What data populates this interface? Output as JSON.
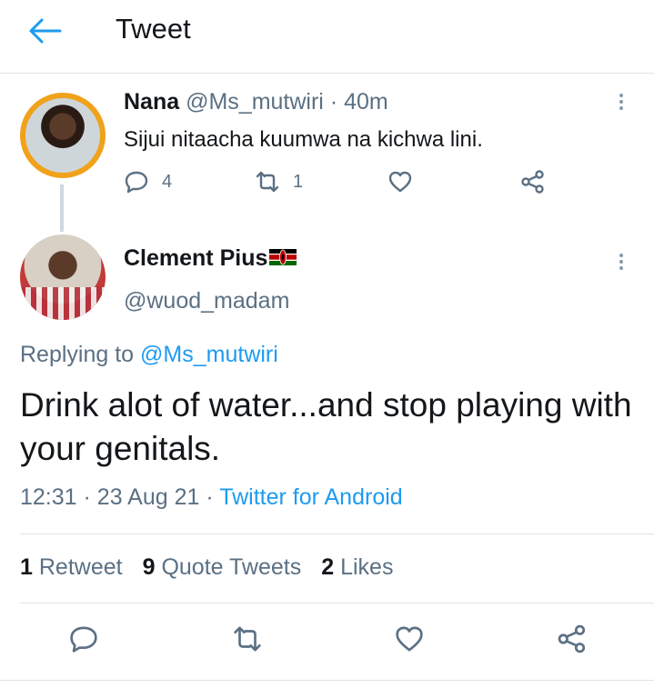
{
  "header": {
    "title": "Tweet"
  },
  "parent_tweet": {
    "name": "Nana",
    "handle": "@Ms_mutwiri",
    "separator": "·",
    "time": "40m",
    "text": "Sijui nitaacha kuumwa na kichwa lini.",
    "reply_count": "4",
    "retweet_count": "1"
  },
  "main_tweet": {
    "name": "Clement Pius",
    "handle": "@wuod_madam",
    "replying_prefix": "Replying to ",
    "replying_to": "@Ms_mutwiri",
    "text": "Drink alot of water...and stop playing with your genitals.",
    "time": "12:31",
    "date": "23 Aug 21",
    "separator": "·",
    "source": "Twitter for Android"
  },
  "stats": {
    "retweets_count": "1",
    "retweets_label": "Retweet",
    "quotes_count": "9",
    "quotes_label": "Quote Tweets",
    "likes_count": "2",
    "likes_label": "Likes"
  },
  "colors": {
    "accent": "#1d9bf0",
    "muted": "#5b7083",
    "avatar_ring": "#f0a21b"
  }
}
